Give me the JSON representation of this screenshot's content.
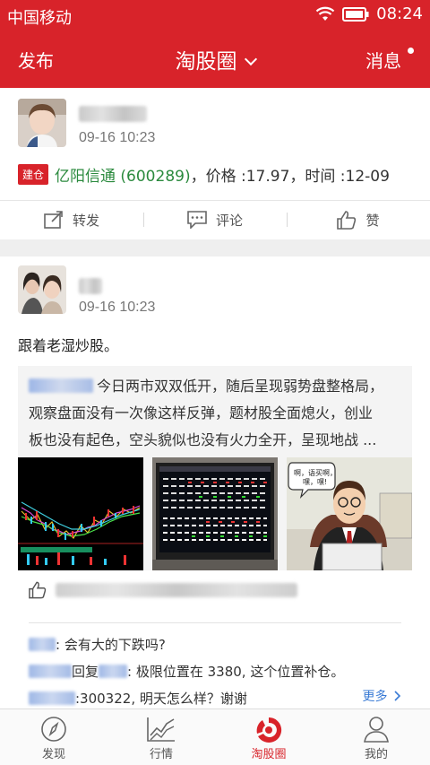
{
  "status_bar": {
    "carrier": "中国移动",
    "time": "08:24"
  },
  "nav": {
    "left": "发布",
    "title": "淘股圈",
    "right": "消息"
  },
  "post1": {
    "timestamp": "09-16  10:23",
    "badge": "建仓",
    "stock": "亿阳信通 (600289)",
    "trade_rest": "，价格 :17.97，时间 :12-09",
    "actions": {
      "forward": "转发",
      "comment": "评论",
      "like": "赞"
    }
  },
  "post2": {
    "timestamp": "09-16  10:23",
    "text": "跟着老湿炒股。",
    "quote_line1": "今日两市双双低开，随后呈现弱势盘整格局，",
    "quote_line2": "观察盘面没有一次像这样反弹，题材股全面熄火，创业",
    "quote_line3": "板也没有起色，空头貌似也没有火力全开，呈现地战 ...",
    "comments": [
      {
        "reply": "",
        "text": " : 会有大的下跌吗?"
      },
      {
        "reply": "回复",
        "text": " : 极限位置在 3380, 这个位置补仓。"
      },
      {
        "reply": "",
        "text": " :300322, 明天怎么样？谢谢"
      }
    ],
    "more": "更多"
  },
  "tabs": [
    {
      "label": "发现",
      "icon": "compass-icon"
    },
    {
      "label": "行情",
      "icon": "chart-icon"
    },
    {
      "label": "淘股圈",
      "icon": "taoguquan-icon"
    },
    {
      "label": "我的",
      "icon": "person-icon"
    }
  ],
  "colors": {
    "brand_red": "#d8232a",
    "stock_green": "#2b8a3e",
    "link_blue": "#3a7bd5"
  }
}
